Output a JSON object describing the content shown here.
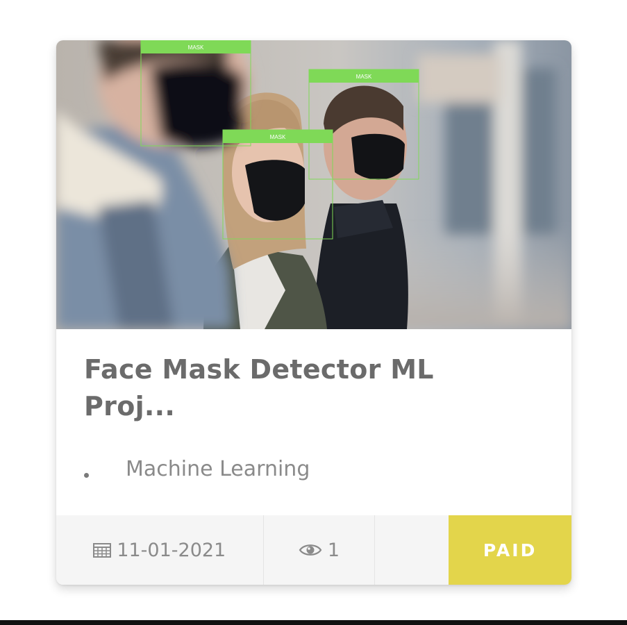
{
  "card": {
    "title": "Face Mask Detector ML Proj...",
    "category": "Machine Learning",
    "detections": [
      {
        "label": "MASK"
      },
      {
        "label": "MASK"
      },
      {
        "label": "MASK"
      }
    ],
    "footer": {
      "date": "11-01-2021",
      "views": "1",
      "badge": "PAID",
      "calendar_icon": "calendar-grid-icon",
      "views_icon": "eye-icon"
    }
  },
  "colors": {
    "title": "#6b6b6b",
    "text_muted": "#8a8a8a",
    "badge_bg": "#e3d54b",
    "badge_text": "#ffffff",
    "footer_bg": "#f5f5f5",
    "detection_box": "#7fd957"
  }
}
